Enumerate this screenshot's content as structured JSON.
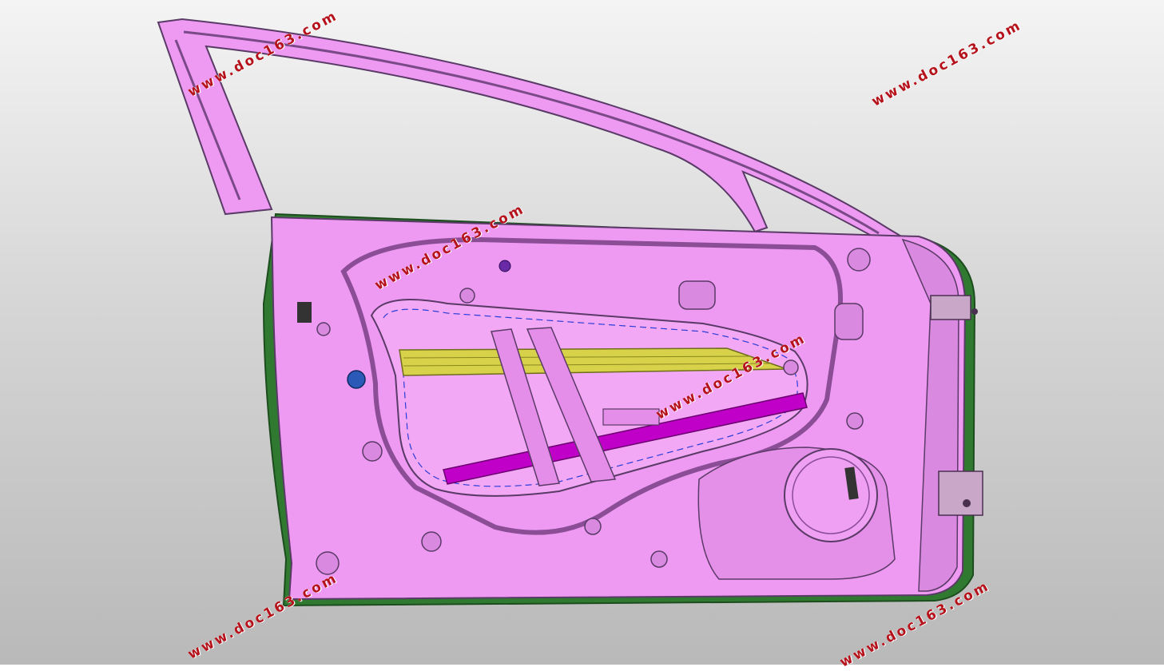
{
  "viewport": {
    "background": [
      "#f4f4f4",
      "#b9b9b9"
    ]
  },
  "model": {
    "part": "door-inner-panel",
    "colors": {
      "panel": "#ee9af2",
      "panel_shade": "#cf7fd6",
      "edge": "#5a3a66",
      "flange": "#2f7a30",
      "glass_channel": "#d7d24a",
      "regulator_rail": "#c000c8",
      "blue_plug": "#2a59b8",
      "dash": "#2b3dd6"
    }
  },
  "watermark": {
    "text": "www.doc163.com",
    "color": "#b5121b"
  }
}
